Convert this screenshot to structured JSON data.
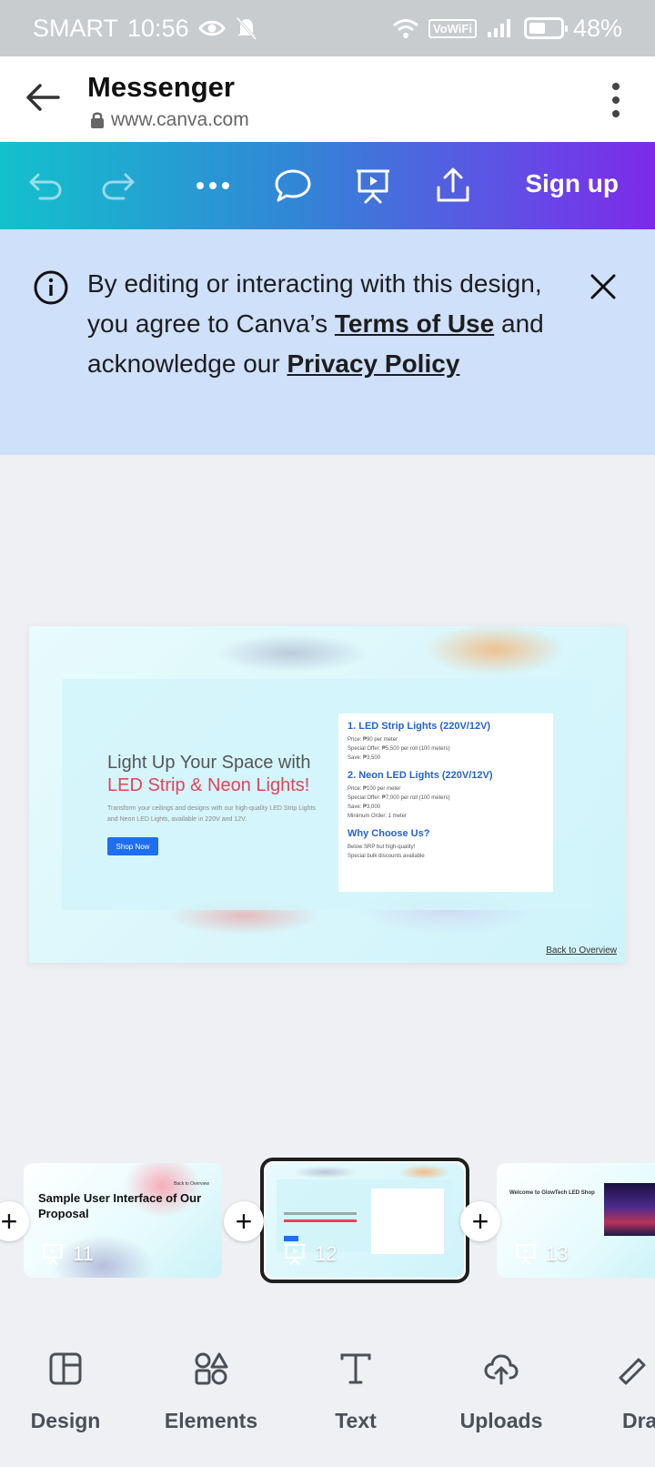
{
  "status_bar": {
    "carrier": "SMART",
    "time": "10:56",
    "vowifi": "VoWiFi",
    "battery": "48%"
  },
  "browser": {
    "title": "Messenger",
    "url": "www.canva.com"
  },
  "toolbar": {
    "signup_label": "Sign up"
  },
  "notice": {
    "text_1": "By editing or interacting with this design, you agree to Canva’s ",
    "terms_link": "Terms of Use",
    "text_2": " and acknowledge our ",
    "privacy_link": "Privacy Policy"
  },
  "slide": {
    "heading_1": "Light Up Your Space with",
    "heading_2": "LED Strip & Neon Lights!",
    "subtext": "Transform your ceilings and designs with our high-quality LED Strip Lights and Neon LED Lights, available in 220V and 12V.",
    "shop_button": "Shop Now",
    "card": {
      "item1_title": "1. LED Strip Lights (220V/12V)",
      "item1_lines": [
        "Price: ₱90 per meter",
        "Special Offer: ₱5,500 per roll (100 meters)",
        "Save: ₱3,500"
      ],
      "item2_title": "2. Neon LED Lights (220V/12V)",
      "item2_lines": [
        "Price: ₱100 per meter",
        "Special Offer: ₱7,000 per roll (100 meters)",
        "Save: ₱3,000",
        "Minimum Order: 1 meter"
      ],
      "why_title": "Why Choose Us?",
      "why_lines": [
        "Below SRP but high-quality!",
        "Special bulk discounts available"
      ]
    },
    "back_link": "Back to Overview"
  },
  "thumbnails": [
    {
      "number": "11",
      "title": "Sample User Interface of Our Proposal",
      "corner": "Back to Overview"
    },
    {
      "number": "12"
    },
    {
      "number": "13",
      "title": "Welcome to GlowTech LED Shop"
    }
  ],
  "add_symbol": "+",
  "bottom_nav": [
    {
      "label": "Design"
    },
    {
      "label": "Elements"
    },
    {
      "label": "Text"
    },
    {
      "label": "Uploads"
    },
    {
      "label": "Dra"
    }
  ]
}
